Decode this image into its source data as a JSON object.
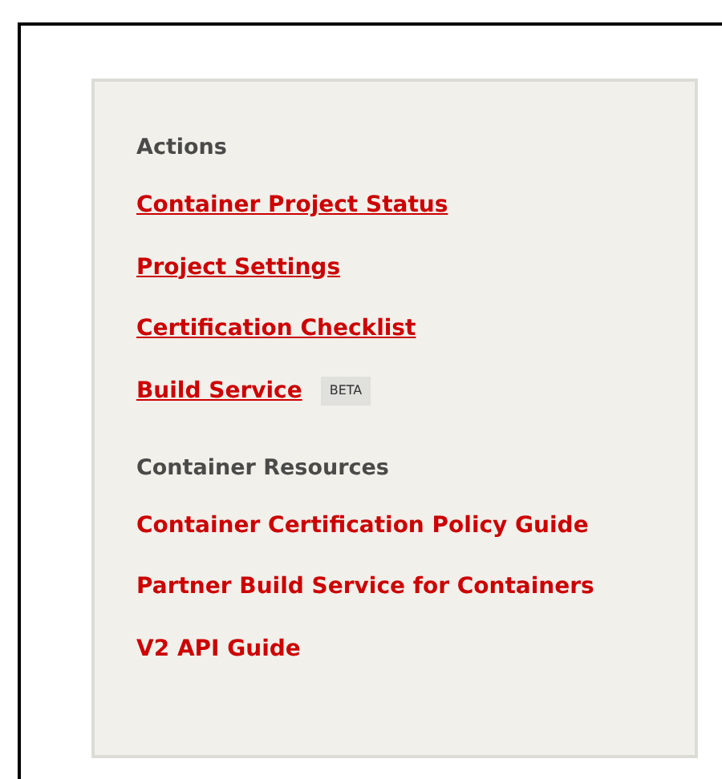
{
  "sections": [
    {
      "heading": "Actions",
      "links": [
        {
          "label": "Container Project Status",
          "underlined": true
        },
        {
          "label": "Project Settings",
          "underlined": true
        },
        {
          "label": "Certification Checklist",
          "underlined": true
        },
        {
          "label": "Build Service",
          "underlined": true,
          "badge": "BETA"
        }
      ]
    },
    {
      "heading": "Container Resources",
      "links": [
        {
          "label": "Container Certification Policy Guide",
          "underlined": false
        },
        {
          "label": "Partner Build Service for Containers",
          "underlined": false
        },
        {
          "label": "V2 API Guide",
          "underlined": false
        }
      ]
    }
  ]
}
